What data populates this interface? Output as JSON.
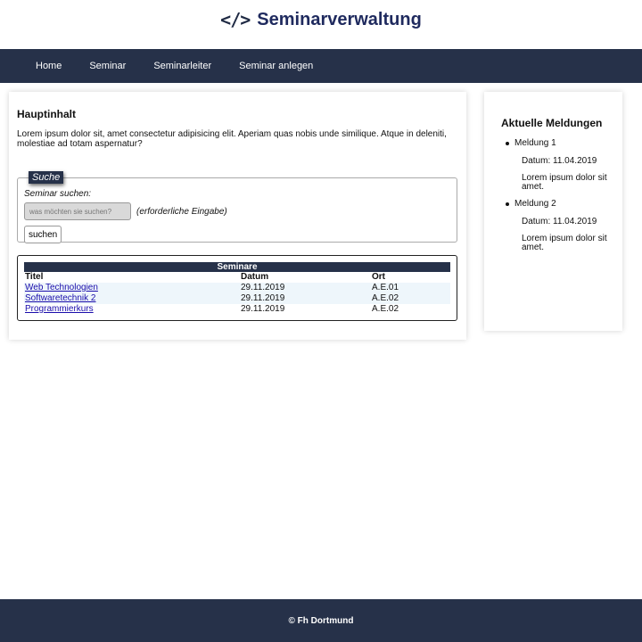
{
  "header": {
    "icon": "code-icon",
    "icon_glyph": "</>",
    "title": "Seminarverwaltung"
  },
  "nav": {
    "items": [
      {
        "label": "Home"
      },
      {
        "label": "Seminar"
      },
      {
        "label": "Seminarleiter"
      },
      {
        "label": "Seminar anlegen"
      }
    ]
  },
  "main": {
    "heading": "Hauptinhalt",
    "lead": "Lorem ipsum dolor sit, amet consectetur adipisicing elit. Aperiam quas nobis unde similique. Atque in deleniti, molestiae ad totam aspernatur?",
    "search": {
      "legend": "Suche",
      "label": "Seminar suchen:",
      "placeholder": "was möchten sie suchen?",
      "value": "",
      "hint": "(erforderliche Eingabe)",
      "button": "suchen"
    },
    "table": {
      "caption": "Seminare",
      "headers": [
        "Titel",
        "Datum",
        "Ort"
      ],
      "rows": [
        {
          "title": "Web Technologien",
          "date": "29.11.2019",
          "room": "A.E.01"
        },
        {
          "title": "Softwaretechnik 2",
          "date": "29.11.2019",
          "room": "A.E.02"
        },
        {
          "title": "Programmierkurs",
          "date": "29.11.2019",
          "room": "A.E.02"
        }
      ]
    }
  },
  "aside": {
    "heading": "Aktuelle Meldungen",
    "items": [
      {
        "title": "Meldung 1",
        "date": "Datum: 11.04.2019",
        "text": "Lorem ipsum dolor sit amet."
      },
      {
        "title": "Meldung 2",
        "date": "Datum: 11.04.2019",
        "text": "Lorem ipsum dolor sit amet."
      }
    ]
  },
  "footer": {
    "text": "© Fh Dortmund"
  },
  "colors": {
    "navy": "#263149",
    "title": "#1f2a5e",
    "link": "#1a0dab",
    "row_alt": "#eef6fb"
  }
}
